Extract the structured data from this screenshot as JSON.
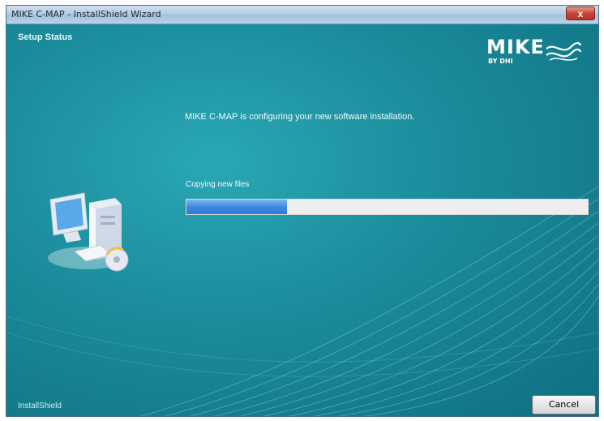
{
  "window": {
    "title": "MIKE C-MAP - InstallShield Wizard",
    "close_glyph": "x"
  },
  "header": {
    "section_title": "Setup Status"
  },
  "logo": {
    "text": "MIKE",
    "subtext": "BY DHI"
  },
  "main": {
    "message": "MIKE C-MAP is configuring your new software installation.",
    "progress_label": "Copying new files",
    "progress_fraction": 0.25
  },
  "footer": {
    "brand": "InstallShield",
    "cancel_label": "Cancel"
  },
  "icons": {
    "computer": "computer-install-icon",
    "logo_wave": "mike-wave-logo-icon",
    "close": "close-icon"
  },
  "colors": {
    "background": "#1f8f9e",
    "progress_fill": "#3c8be0",
    "progress_track": "#eeeeee"
  }
}
